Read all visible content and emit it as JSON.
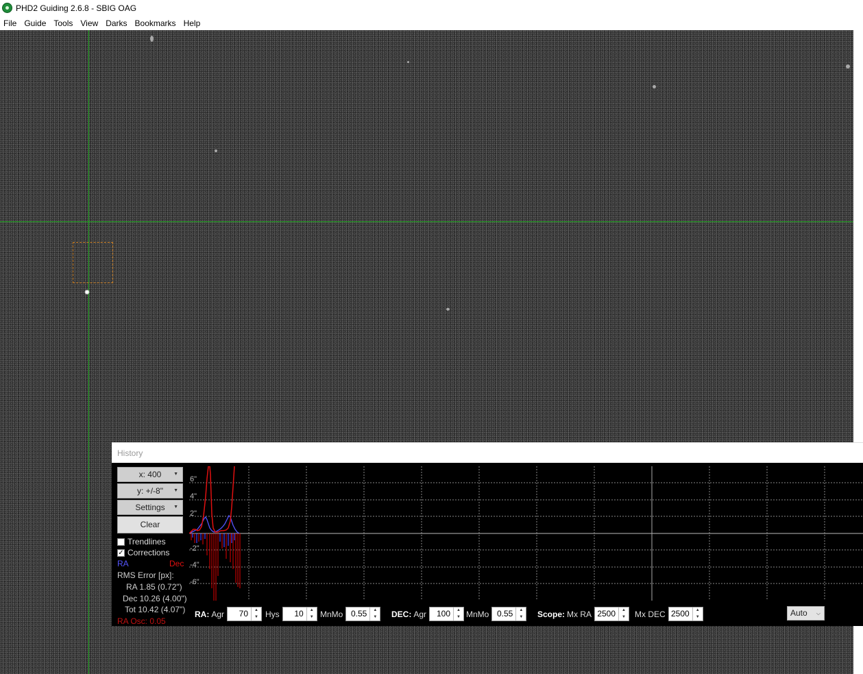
{
  "window": {
    "title": "PHD2 Guiding 2.6.8 - SBIG OAG"
  },
  "menu": [
    "File",
    "Guide",
    "Tools",
    "View",
    "Darks",
    "Bookmarks",
    "Help"
  ],
  "history": {
    "title": "History",
    "x_scale": "x: 400",
    "y_scale": "y: +/-8\"",
    "settings_label": "Settings",
    "clear_label": "Clear",
    "trendlines": {
      "label": "Trendlines",
      "checked": false
    },
    "corrections": {
      "label": "Corrections",
      "checked": true
    },
    "legend": {
      "ra": "RA",
      "dec": "Dec"
    },
    "colors": {
      "ra": "#5555ff",
      "dec": "#ff1a1a"
    },
    "rms_header": "RMS Error [px]:",
    "rms_ra": "RA 1.85 (0.72\")",
    "rms_dec": "Dec 10.26 (4.00\")",
    "rms_tot": "Tot 10.42 (4.07\")",
    "ra_osc": "RA Osc: 0.05",
    "y_ticks": [
      "6\"",
      "4\"",
      "2\"",
      "-2\"",
      "-4\"",
      "-6\""
    ]
  },
  "controls": {
    "ra_label": "RA:",
    "ra_agr_label": "Agr",
    "ra_agr": "70",
    "hys_label": "Hys",
    "hys": "10",
    "ra_mnmo_label": "MnMo",
    "ra_mnmo": "0.55",
    "dec_label": "DEC:",
    "dec_agr_label": "Agr",
    "dec_agr": "100",
    "dec_mnmo_label": "MnMo",
    "dec_mnmo": "0.55",
    "scope_label": "Scope:",
    "mx_ra_label": "Mx RA",
    "mx_ra": "2500",
    "mx_dec_label": "Mx DEC",
    "mx_dec": "2500",
    "dec_mode": "Auto"
  }
}
